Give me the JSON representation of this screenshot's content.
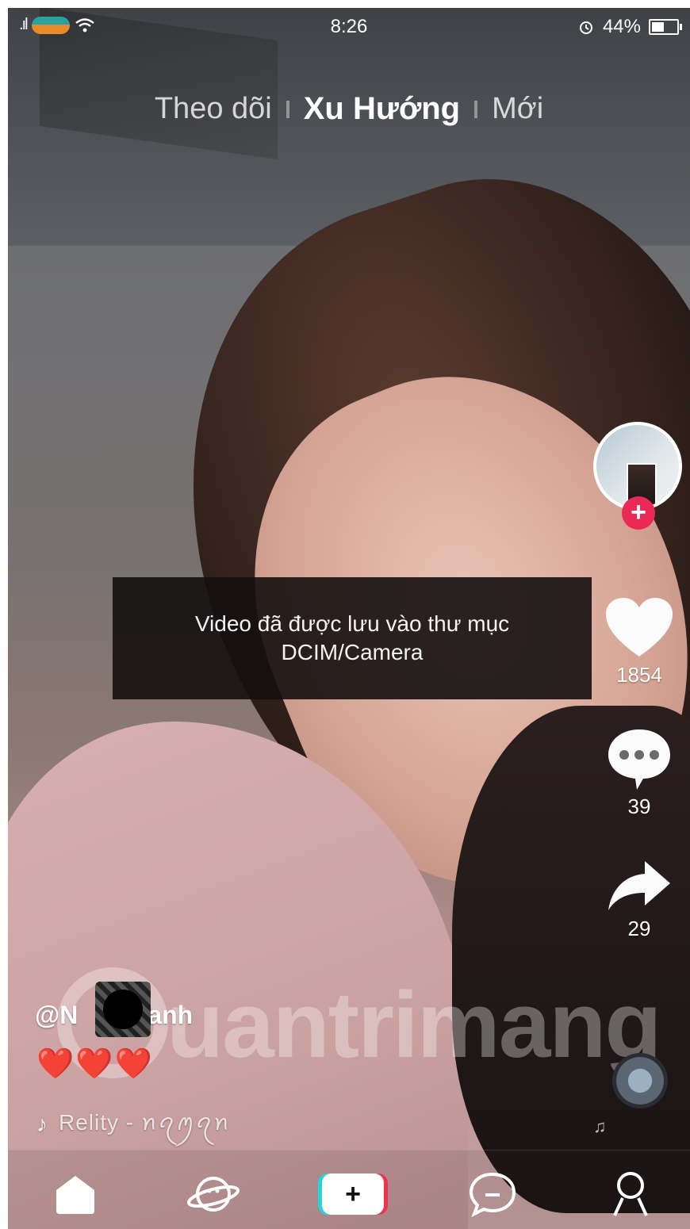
{
  "status_bar": {
    "signal": ".ıl",
    "time": "8:26",
    "battery_percent": "44%",
    "battery_level": 0.44
  },
  "top_tabs": {
    "following": "Theo dõi",
    "trending": "Xu Hướng",
    "new": "Mới",
    "active": "trending"
  },
  "toast": {
    "line1": "Video đã được lưu vào thư mục",
    "line2": "DCIM/Camera"
  },
  "actions": {
    "likes": "1854",
    "comments": "39",
    "shares": "29",
    "follow_plus": "+"
  },
  "post": {
    "username_start": "@N",
    "username_end": "anh",
    "caption": "❤️❤️❤️",
    "music_icon": "♪",
    "music_text": "Relity - ꪀꪖꪑꪖꪀ"
  },
  "watermark": "uantrimang",
  "nav": {
    "create_plus": "+"
  },
  "colors": {
    "accent_red": "#ea2a55",
    "tiktok_cyan": "#27d3de",
    "tiktok_red": "#f0314f"
  },
  "icons": {
    "home": "home-icon",
    "discover": "planet-icon",
    "create": "plus-icon",
    "inbox": "message-icon",
    "profile": "profile-icon",
    "like": "heart-icon",
    "comment": "comment-icon",
    "share": "share-icon",
    "wifi": "wifi-icon",
    "alarm": "alarm-icon",
    "battery": "battery-icon"
  }
}
